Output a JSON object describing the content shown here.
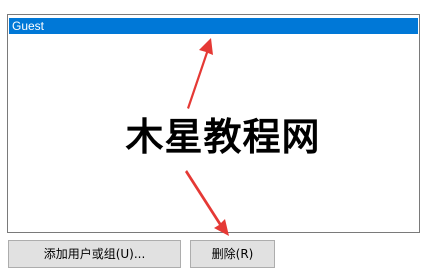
{
  "list": {
    "items": [
      {
        "label": "Guest",
        "selected": true
      }
    ],
    "selection_color": "#0078d7"
  },
  "watermark": {
    "text": "木星教程网"
  },
  "buttons": {
    "add_label": "添加用户或组(U)...",
    "remove_label": "删除(R)"
  },
  "annotation": {
    "arrow_color": "#e53935"
  }
}
